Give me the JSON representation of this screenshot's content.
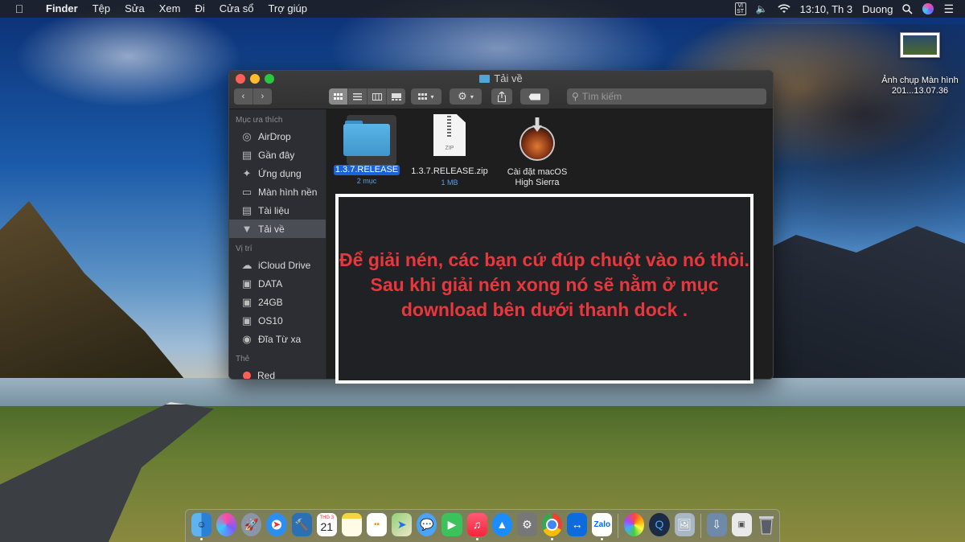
{
  "menubar": {
    "app_name": "Finder",
    "menus": [
      "Tệp",
      "Sửa",
      "Xem",
      "Đi",
      "Cửa sổ",
      "Trợ giúp"
    ],
    "input_source": "VI\nST",
    "clock": "13:10, Th 3",
    "user": "Duong"
  },
  "desktop": {
    "screenshot_label": "Ảnh chụp Màn hình 201...13.07.36"
  },
  "finder": {
    "title": "Tải về",
    "search_placeholder": "Tìm kiếm",
    "view_mode": "icon",
    "sidebar": {
      "favorites_header": "Mục ưa thích",
      "favorites": [
        {
          "label": "AirDrop",
          "icon": "airdrop-icon"
        },
        {
          "label": "Gần đây",
          "icon": "clock-icon"
        },
        {
          "label": "Ứng dụng",
          "icon": "apps-icon"
        },
        {
          "label": "Màn hình nền",
          "icon": "desktop-icon"
        },
        {
          "label": "Tài liệu",
          "icon": "document-icon"
        },
        {
          "label": "Tải về",
          "icon": "download-icon",
          "selected": true
        }
      ],
      "locations_header": "Vị trí",
      "locations": [
        {
          "label": "iCloud Drive",
          "icon": "cloud-icon"
        },
        {
          "label": "DATA",
          "icon": "disk-icon"
        },
        {
          "label": "24GB",
          "icon": "disk-icon"
        },
        {
          "label": "OS10",
          "icon": "disk-icon"
        },
        {
          "label": "Đĩa Từ xa",
          "icon": "remote-disc-icon"
        }
      ],
      "tags_header": "Thẻ",
      "tags": [
        {
          "label": "Red",
          "color": "#ff5f57"
        }
      ]
    },
    "files": [
      {
        "name": "1.3.7.RELEASE",
        "sub": "2 mục",
        "kind": "folder",
        "selected": true
      },
      {
        "name": "1.3.7.RELEASE.zip",
        "sub": "1 MB",
        "kind": "zip"
      },
      {
        "name": "Cài đặt macOS High Sierra",
        "sub": "",
        "kind": "installer"
      }
    ]
  },
  "annotation": {
    "text": "Để giải nén, các bạn cứ đúp chuột vào nó thôi.\nSau khi giải nén xong nó sẽ nằm ở mục download bên dưới thanh dock .",
    "color": "#e8373d"
  },
  "dock": {
    "calendar_month": "THG 3",
    "calendar_day": "21",
    "zalo_label": "Zalo",
    "apps": [
      "Finder",
      "Siri",
      "Launchpad",
      "Safari",
      "Xcode",
      "Calendar",
      "Notes",
      "Reminders",
      "Maps",
      "Messages",
      "FaceTime",
      "Music",
      "App Store",
      "System Preferences",
      "Chrome",
      "TeamViewer",
      "Zalo",
      "Photos",
      "QuickTime",
      "Preview",
      "Downloads",
      "Trash"
    ]
  }
}
